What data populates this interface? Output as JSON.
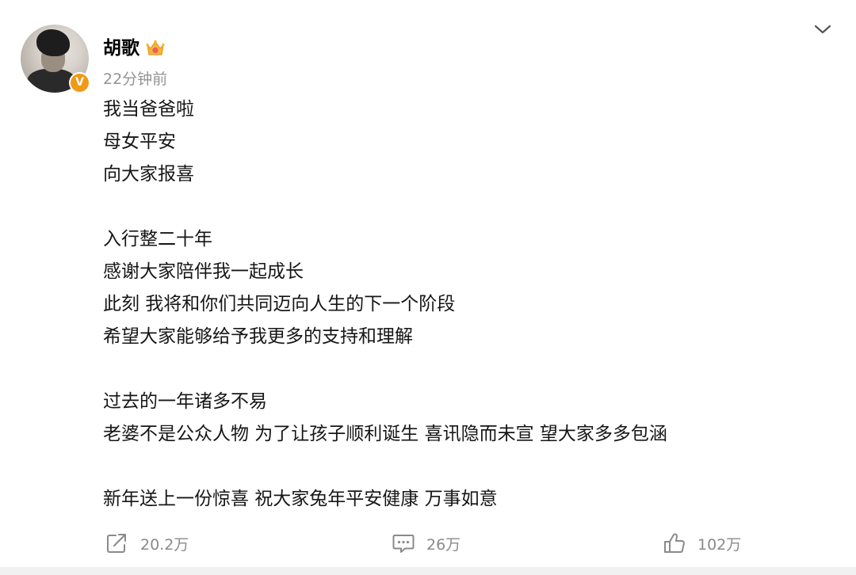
{
  "post": {
    "author": "胡歌",
    "timestamp": "22分钟前",
    "lines": [
      "我当爸爸啦",
      "母女平安",
      "向大家报喜",
      "",
      "入行整二十年",
      "感谢大家陪伴我一起成长",
      "此刻 我将和你们共同迈向人生的下一个阶段",
      "希望大家能够给予我更多的支持和理解",
      "",
      "过去的一年诸多不易",
      "老婆不是公众人物 为了让孩子顺利诞生 喜讯隐而未宣 望大家多多包涵",
      "",
      "新年送上一份惊喜 祝大家兔年平安健康 万事如意"
    ]
  },
  "badges": {
    "verified_letter": "V",
    "verified_color": "#f09a15",
    "member_icon": "crown-icon"
  },
  "actions": {
    "share": {
      "icon": "share-icon",
      "count": "20.2万"
    },
    "comment": {
      "icon": "comment-icon",
      "count": "26万"
    },
    "like": {
      "icon": "thumbs-up-icon",
      "count": "102万"
    }
  },
  "header": {
    "menu_icon": "chevron-down-icon"
  },
  "colors": {
    "text_primary": "#161616",
    "text_secondary": "#939393",
    "action_gray": "#8a8a8a",
    "accent_orange": "#f09a15"
  }
}
